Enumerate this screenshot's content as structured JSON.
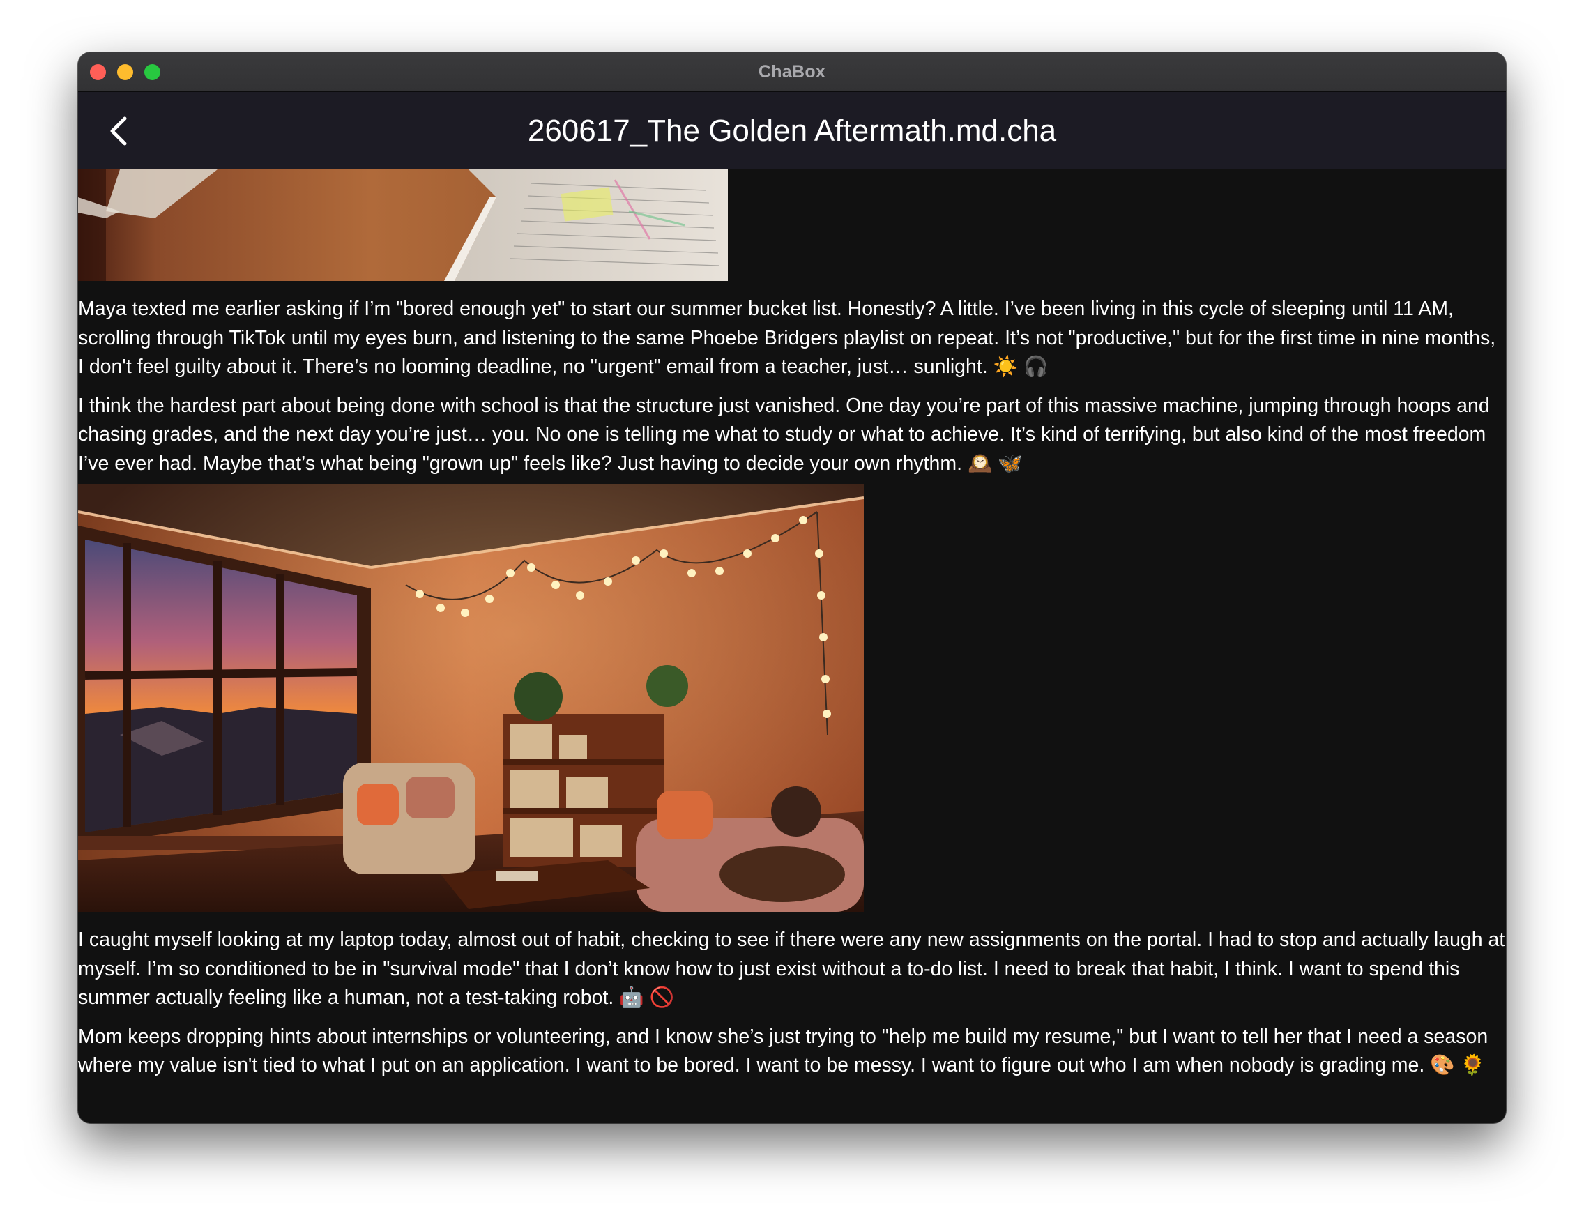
{
  "window": {
    "app_title": "ChaBox"
  },
  "navbar": {
    "back_icon": "chevron-left-icon",
    "title": "260617_The Golden Aftermath.md.cha"
  },
  "entry": {
    "images": [
      {
        "name": "notebook-photo",
        "description_icon": "open-notebook-image"
      },
      {
        "name": "sunset-room-photo",
        "description_icon": "sunset-living-room-image"
      }
    ],
    "paragraphs": [
      "Maya texted me earlier asking if I’m \"bored enough yet\" to start our summer bucket list. Honestly? A little. I’ve been living in this cycle of sleeping until 11 AM, scrolling through TikTok until my eyes burn, and listening to the same Phoebe Bridgers playlist on repeat. It’s not \"productive,\" but for the first time in nine months, I don't feel guilty about it. There’s no looming deadline, no \"urgent\" email from a teacher, just… sunlight. ☀️ 🎧",
      "I think the hardest part about being done with school is that the structure just vanished. One day you’re part of this massive machine, jumping through hoops and chasing grades, and the next day you’re just… you. No one is telling me what to study or what to achieve. It’s kind of terrifying, but also kind of the most freedom I’ve ever had. Maybe that’s what being \"grown up\" feels like? Just having to decide your own rhythm. 🕰️ 🦋",
      "I caught myself looking at my laptop today, almost out of habit, checking to see if there were any new assignments on the portal. I had to stop and actually laugh at myself. I’m so conditioned to be in \"survival mode\" that I don’t know how to just exist without a to-do list. I need to break that habit, I think. I want to spend this summer actually feeling like a human, not a test-taking robot. 🤖 🚫",
      "Mom keeps dropping hints about internships or volunteering, and I know she’s just trying to \"help me build my resume,\" but I want to tell her that I need a season where my value isn't tied to what I put on an application. I want to be bored. I want to be messy. I want to figure out who I am when nobody is grading me. 🎨 🌻"
    ]
  },
  "colors": {
    "background": "#111111",
    "navbar": "#1c1b24",
    "titlebar": "#323234",
    "text": "#ffffff"
  }
}
